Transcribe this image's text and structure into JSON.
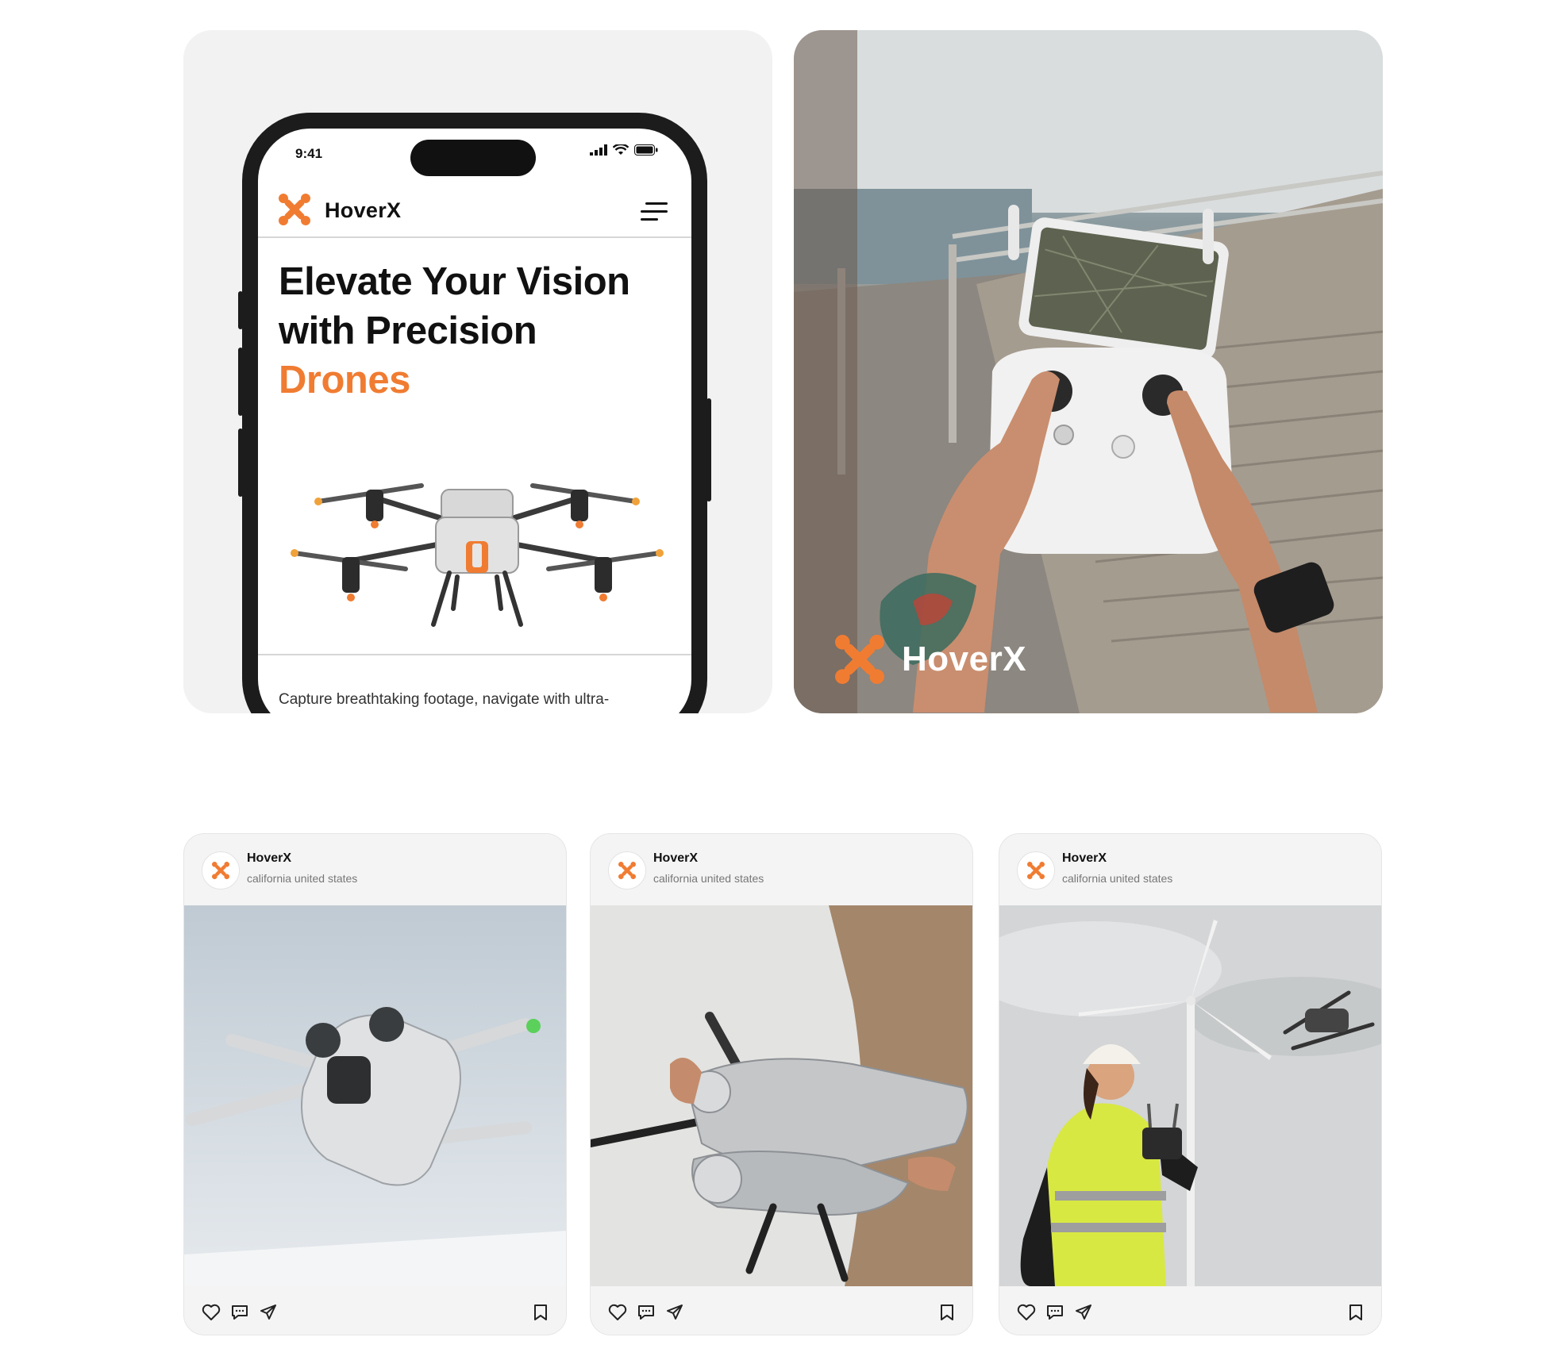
{
  "colors": {
    "accent": "#f07c32",
    "ink": "#111111",
    "card_bg": "#f2f2f2"
  },
  "phone_mockup": {
    "status_time": "9:41",
    "brand_name": "HoverX",
    "icons": {
      "logo": "hoverx-x-icon",
      "menu": "hamburger-menu-icon"
    },
    "hero": {
      "line1": "Elevate Your Vision",
      "line2": "with Precision",
      "accent": "Drones"
    },
    "description": "Capture breathtaking footage, navigate with ultra-stability, and fly smarter — meet"
  },
  "photo_card": {
    "brand_name": "HoverX"
  },
  "posts": [
    {
      "user": "HoverX",
      "location": "california united states"
    },
    {
      "user": "HoverX",
      "location": "california united states"
    },
    {
      "user": "HoverX",
      "location": "california united states"
    }
  ]
}
